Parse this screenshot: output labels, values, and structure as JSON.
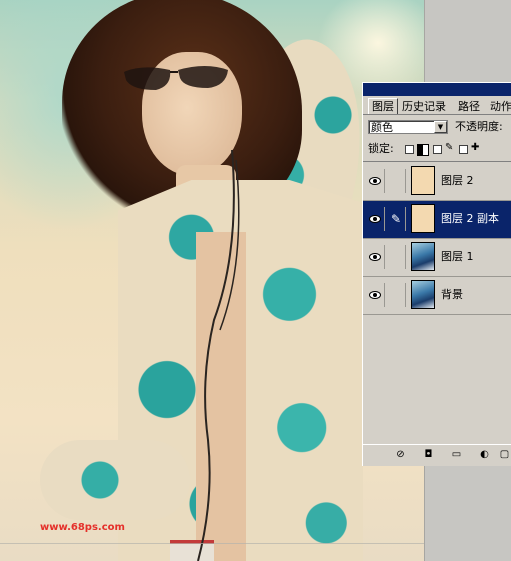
{
  "watermark": "www.68ps.com",
  "palette": {
    "tabs": [
      "图层",
      "历史记录",
      "路径",
      "动作"
    ],
    "blend_mode": "颜色",
    "opacity_label": "不透明度:",
    "lock_label": "锁定:",
    "layers": [
      {
        "name": "图层 2",
        "thumb": "cream",
        "visible": true,
        "selected": false,
        "brush": false
      },
      {
        "name": "图层 2 副本",
        "thumb": "cream",
        "visible": true,
        "selected": true,
        "brush": true
      },
      {
        "name": "图层 1",
        "thumb": "photo",
        "visible": true,
        "selected": false,
        "brush": false
      },
      {
        "name": "背景",
        "thumb": "photo",
        "visible": true,
        "selected": false,
        "brush": false
      }
    ],
    "bottom_icons": [
      "layer-style-icon",
      "add-mask-icon",
      "new-group-icon",
      "adjustment-layer-icon",
      "new-layer-icon"
    ],
    "colors": {
      "selected": "#0a246a",
      "panel": "#d4d0c8"
    }
  }
}
